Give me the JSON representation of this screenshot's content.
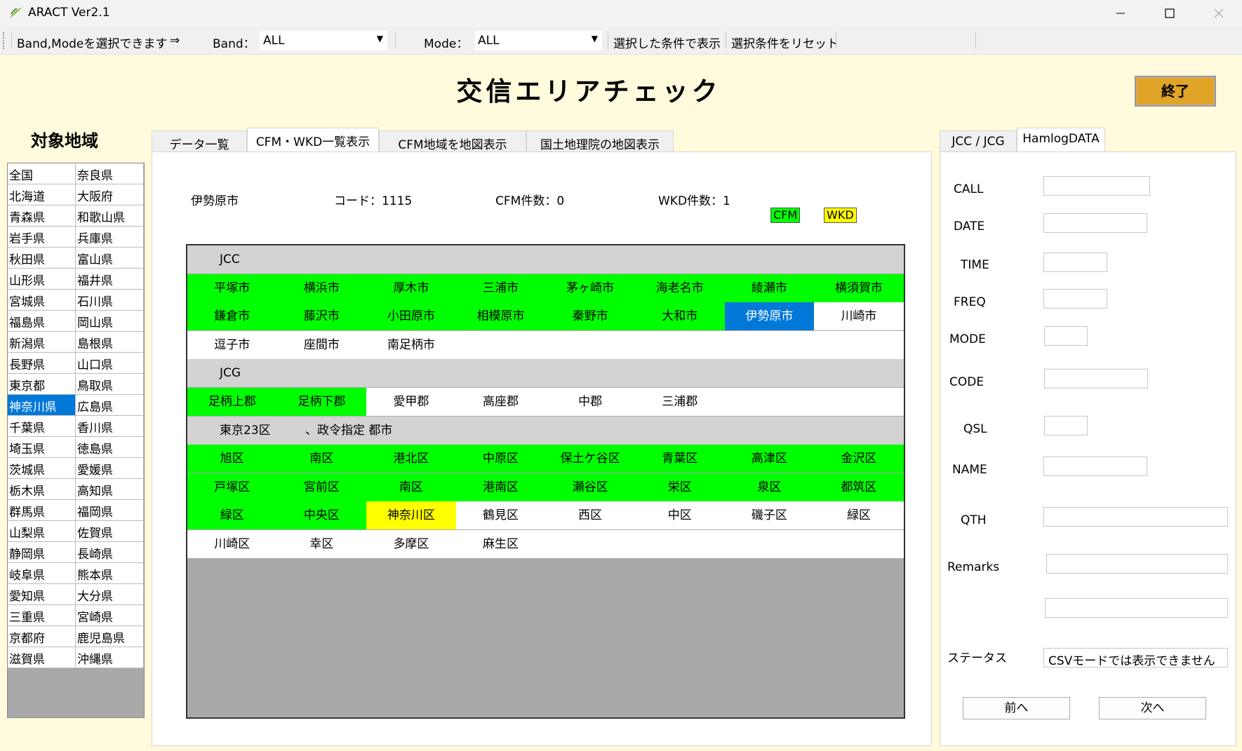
{
  "window": {
    "title": "ARACT Ver2.1"
  },
  "toolbar": {
    "hint": "Band,Modeを選択できます",
    "arrow": "⇒",
    "band_label": "Band：",
    "band_value": "ALL",
    "mode_label": "Mode：",
    "mode_value": "ALL",
    "show_button": "選択した条件で表示",
    "reset_button": "選択条件をリセット"
  },
  "page_title": "交信エリアチェック",
  "exit_button": "終了",
  "region_title": "対象地域",
  "prefectures": [
    [
      "全国",
      "奈良県"
    ],
    [
      "北海道",
      "大阪府"
    ],
    [
      "青森県",
      "和歌山県"
    ],
    [
      "岩手県",
      "兵庫県"
    ],
    [
      "秋田県",
      "富山県"
    ],
    [
      "山形県",
      "福井県"
    ],
    [
      "宮城県",
      "石川県"
    ],
    [
      "福島県",
      "岡山県"
    ],
    [
      "新潟県",
      "島根県"
    ],
    [
      "長野県",
      "山口県"
    ],
    [
      "東京都",
      "鳥取県"
    ],
    [
      "神奈川県",
      "広島県"
    ],
    [
      "千葉県",
      "香川県"
    ],
    [
      "埼玉県",
      "徳島県"
    ],
    [
      "茨城県",
      "愛媛県"
    ],
    [
      "栃木県",
      "高知県"
    ],
    [
      "群馬県",
      "福岡県"
    ],
    [
      "山梨県",
      "佐賀県"
    ],
    [
      "静岡県",
      "長崎県"
    ],
    [
      "岐阜県",
      "熊本県"
    ],
    [
      "愛知県",
      "大分県"
    ],
    [
      "三重県",
      "宮崎県"
    ],
    [
      "京都府",
      "鹿児島県"
    ],
    [
      "滋賀県",
      "沖縄県"
    ]
  ],
  "selected_prefecture": "神奈川県",
  "tabs_main": [
    "データ一覧",
    "CFM・WKD一覧表示",
    "CFM地域を地図表示",
    "国土地理院の地図表示"
  ],
  "active_tab_main": "CFM・WKD一覧表示",
  "info": {
    "city": "伊勢原市",
    "code": "コード：1115",
    "cfm_count": "CFM件数：0",
    "wkd_count": "WKD件数：1"
  },
  "legend": {
    "cfm": "CFM",
    "wkd": "WKD",
    "cfm_color": "#00ff00",
    "wkd_color": "#ffff00"
  },
  "grid": {
    "jcc_header": "JCC",
    "jcc": [
      [
        [
          "平塚市",
          "g"
        ],
        [
          "横浜市",
          "g"
        ],
        [
          "厚木市",
          "g"
        ],
        [
          "三浦市",
          "g"
        ],
        [
          "茅ヶ崎市",
          "g"
        ],
        [
          "海老名市",
          "g"
        ],
        [
          "綾瀬市",
          "g"
        ],
        [
          "横須賀市",
          "g"
        ]
      ],
      [
        [
          "鎌倉市",
          "g"
        ],
        [
          "藤沢市",
          "g"
        ],
        [
          "小田原市",
          "g"
        ],
        [
          "相模原市",
          "g"
        ],
        [
          "秦野市",
          "g"
        ],
        [
          "大和市",
          "g"
        ],
        [
          "伊勢原市",
          "b"
        ],
        [
          "川崎市",
          "w"
        ]
      ],
      [
        [
          "逗子市",
          "w"
        ],
        [
          "座間市",
          "w"
        ],
        [
          "南足柄市",
          "w"
        ]
      ]
    ],
    "jcg_header": "JCG",
    "jcg": [
      [
        [
          "足柄上郡",
          "g"
        ],
        [
          "足柄下郡",
          "g"
        ],
        [
          "愛甲郡",
          "w"
        ],
        [
          "高座郡",
          "w"
        ],
        [
          "中郡",
          "w"
        ],
        [
          "三浦郡",
          "w"
        ]
      ]
    ],
    "ku_header_1": "東京23区",
    "ku_header_2": "、政令指定 都市",
    "ku": [
      [
        [
          "旭区",
          "g"
        ],
        [
          "南区",
          "g"
        ],
        [
          "港北区",
          "g"
        ],
        [
          "中原区",
          "g"
        ],
        [
          "保土ケ谷区",
          "g"
        ],
        [
          "青葉区",
          "g"
        ],
        [
          "高津区",
          "g"
        ],
        [
          "金沢区",
          "g"
        ]
      ],
      [
        [
          "戸塚区",
          "g"
        ],
        [
          "宮前区",
          "g"
        ],
        [
          "南区",
          "g"
        ],
        [
          "港南区",
          "g"
        ],
        [
          "瀬谷区",
          "g"
        ],
        [
          "栄区",
          "g"
        ],
        [
          "泉区",
          "g"
        ],
        [
          "都筑区",
          "g"
        ]
      ],
      [
        [
          "緑区",
          "g"
        ],
        [
          "中央区",
          "g"
        ],
        [
          "神奈川区",
          "y"
        ],
        [
          "鶴見区",
          "w"
        ],
        [
          "西区",
          "w"
        ],
        [
          "中区",
          "w"
        ],
        [
          "磯子区",
          "w"
        ],
        [
          "緑区",
          "w"
        ]
      ],
      [
        [
          "川崎区",
          "w"
        ],
        [
          "幸区",
          "w"
        ],
        [
          "多摩区",
          "w"
        ],
        [
          "麻生区",
          "w"
        ]
      ]
    ]
  },
  "tabs_right": [
    "JCC / JCG",
    "HamlogDATA"
  ],
  "active_tab_right": "HamlogDATA",
  "hamlog": {
    "call_label": "CALL",
    "call": "",
    "date_label": "DATE",
    "date": "",
    "time_label": "TIME",
    "time": "",
    "freq_label": "FREQ",
    "freq": "",
    "mode_label": "MODE",
    "mode": "",
    "code_label": "CODE",
    "code": "",
    "qsl_label": "QSL",
    "qsl": "",
    "name_label": "NAME",
    "name": "",
    "qth_label": "QTH",
    "qth": "",
    "remarks_label": "Remarks",
    "remarks1": "",
    "remarks2": "",
    "status_label": "ステータス",
    "status": "CSVモードでは表示できません",
    "prev_button": "前へ",
    "next_button": "次へ"
  }
}
